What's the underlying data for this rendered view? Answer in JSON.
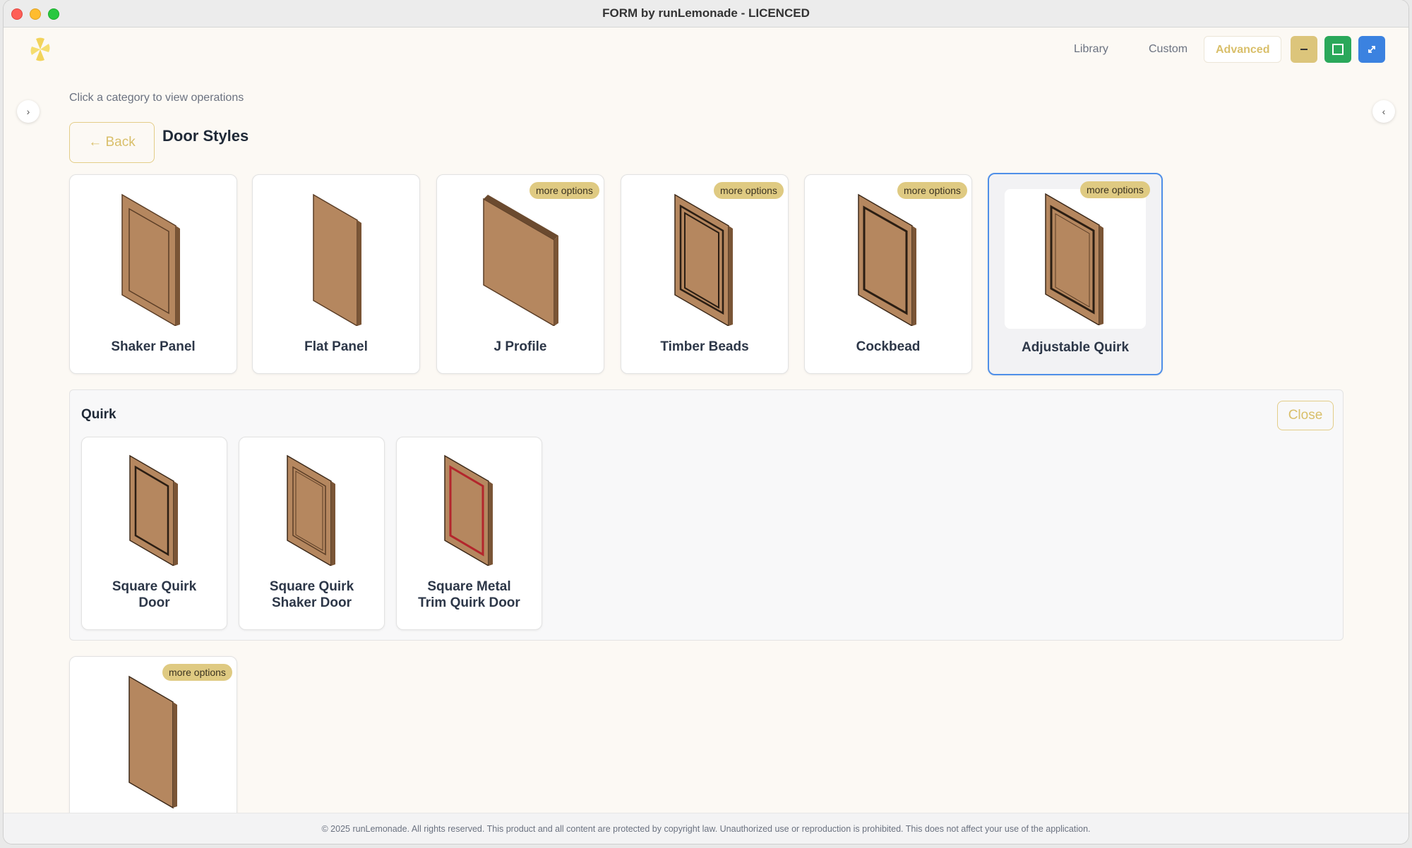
{
  "window": {
    "title": "FORM by runLemonade - LICENCED"
  },
  "header": {
    "logo": "lemon-logo-icon",
    "nav": {
      "library": "Library",
      "custom": "Custom",
      "advanced": "Advanced"
    },
    "window_buttons": {
      "minimize": "minus-icon",
      "maximize": "square-icon",
      "fullscreen": "expand-icon"
    }
  },
  "sidebar": {
    "expand_left": "›",
    "expand_right": "‹"
  },
  "main": {
    "hint": "Click a category to view operations",
    "back_label": "← Back",
    "section_title": "Door Styles",
    "badge_label": "more options",
    "cards": [
      {
        "label": "Shaker Panel",
        "more_options": false,
        "icon": "shaker-panel-door-icon"
      },
      {
        "label": "Flat Panel",
        "more_options": false,
        "icon": "flat-panel-door-icon"
      },
      {
        "label": "J Profile",
        "more_options": true,
        "icon": "j-profile-door-icon"
      },
      {
        "label": "Timber Beads",
        "more_options": true,
        "icon": "timber-beads-door-icon"
      },
      {
        "label": "Cockbead",
        "more_options": true,
        "icon": "cockbead-door-icon"
      },
      {
        "label": "Adjustable Quirk",
        "more_options": true,
        "selected": true,
        "icon": "adjustable-quirk-door-icon"
      }
    ],
    "extra_card": {
      "label": "",
      "more_options": true,
      "icon": "flat-door-icon"
    }
  },
  "quirk_panel": {
    "title": "Quirk",
    "close_label": "Close",
    "items": [
      {
        "line1": "Square Quirk",
        "line2": "Door",
        "icon": "square-quirk-door-icon"
      },
      {
        "line1": "Square Quirk",
        "line2": "Shaker Door",
        "icon": "square-quirk-shaker-door-icon"
      },
      {
        "line1": "Square Metal",
        "line2": "Trim Quirk Door",
        "icon": "square-metal-trim-quirk-door-icon"
      }
    ]
  },
  "footer": {
    "text": "© 2025 runLemonade. All rights reserved. This product and all content are protected by copyright law. Unauthorized use or reproduction is prohibited. This does not affect your use of the application."
  },
  "colors": {
    "accent": "#d9bf6a",
    "badge": "#dfca82",
    "wood": "#b5875f",
    "wood_edge": "#6b4a2f",
    "selected_border": "#4f8fe8",
    "metal_trim": "#b3262c"
  }
}
